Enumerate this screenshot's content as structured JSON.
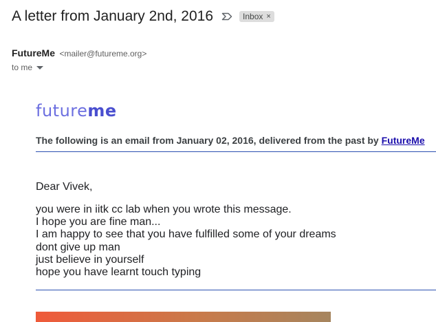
{
  "email": {
    "subject": "A letter from January 2nd, 2016",
    "label": "Inbox",
    "label_remove": "×",
    "sender_name": "FutureMe",
    "sender_email": "<mailer@futureme.org>",
    "recipient": "to me",
    "icons": {
      "important": "important-marker-icon",
      "remove_label": "close-icon",
      "recipient_details": "caret-down-icon"
    }
  },
  "message": {
    "logo_part1": "future",
    "logo_part2": "me",
    "intro_text": "The following is an email from January 02, 2016, delivered from the past by ",
    "intro_link": "FutureMe",
    "greeting": "Dear Vivek,",
    "lines": [
      "you were in iitk cc lab when you wrote this message.",
      "I hope you are fine man...",
      "I am happy to see that you have fulfilled some of your dreams",
      "dont give up man",
      "just believe in yourself",
      "hope you have learnt touch typing"
    ]
  },
  "colors": {
    "logo": "#5b5fd9",
    "link": "#1a0dab",
    "rule": "#2a4fb0",
    "banner_start": "#ef5a3a",
    "banner_end": "#a6855e"
  }
}
